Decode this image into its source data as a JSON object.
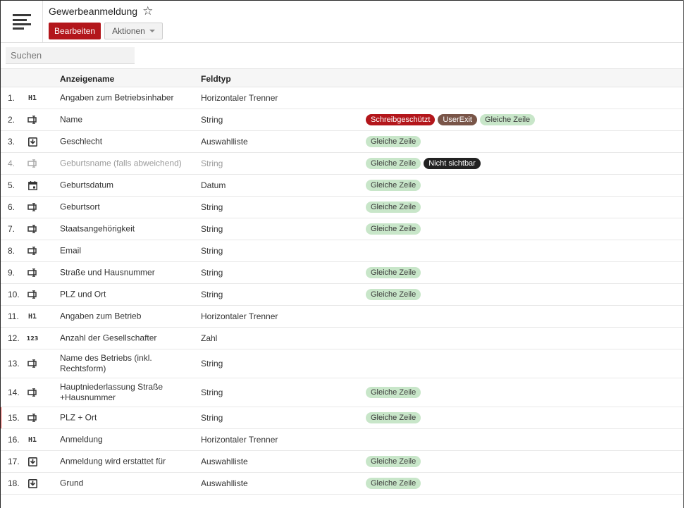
{
  "header": {
    "title": "Gewerbeanmeldung",
    "star_icon": "☆",
    "edit_label": "Bearbeiten",
    "actions_label": "Aktionen"
  },
  "search": {
    "placeholder": "Suchen"
  },
  "table": {
    "columns": {
      "name": "Anzeigename",
      "type": "Feldtyp"
    },
    "rows": [
      {
        "num": "1.",
        "icon": "heading-icon",
        "icon_text": "H1",
        "name": "Angaben zum Betriebsinhaber",
        "type": "Horizontaler Trenner",
        "badges": []
      },
      {
        "num": "2.",
        "icon": "text-field-icon",
        "name": "Name",
        "type": "String",
        "badges": [
          {
            "label": "Schreibgeschützt",
            "style": "red"
          },
          {
            "label": "UserExit",
            "style": "brown"
          },
          {
            "label": "Gleiche Zeile",
            "style": "green"
          }
        ]
      },
      {
        "num": "3.",
        "icon": "dropdown-icon",
        "name": "Geschlecht",
        "type": "Auswahlliste",
        "badges": [
          {
            "label": "Gleiche Zeile",
            "style": "green"
          }
        ]
      },
      {
        "num": "4.",
        "icon": "text-field-icon",
        "name": "Geburtsname (falls abweichend)",
        "type": "String",
        "muted": true,
        "badges": [
          {
            "label": "Gleiche Zeile",
            "style": "green"
          },
          {
            "label": "Nicht sichtbar",
            "style": "black"
          }
        ]
      },
      {
        "num": "5.",
        "icon": "calendar-icon",
        "name": "Geburtsdatum",
        "type": "Datum",
        "badges": [
          {
            "label": "Gleiche Zeile",
            "style": "green"
          }
        ]
      },
      {
        "num": "6.",
        "icon": "text-field-icon",
        "name": "Geburtsort",
        "type": "String",
        "badges": [
          {
            "label": "Gleiche Zeile",
            "style": "green"
          }
        ]
      },
      {
        "num": "7.",
        "icon": "text-field-icon",
        "name": "Staatsangehörigkeit",
        "type": "String",
        "badges": [
          {
            "label": "Gleiche Zeile",
            "style": "green"
          }
        ]
      },
      {
        "num": "8.",
        "icon": "text-field-icon",
        "name": "Email",
        "type": "String",
        "badges": []
      },
      {
        "num": "9.",
        "icon": "text-field-icon",
        "name": "Straße und Hausnummer",
        "type": "String",
        "badges": [
          {
            "label": "Gleiche Zeile",
            "style": "green"
          }
        ]
      },
      {
        "num": "10.",
        "icon": "text-field-icon",
        "name": "PLZ und Ort",
        "type": "String",
        "badges": [
          {
            "label": "Gleiche Zeile",
            "style": "green"
          }
        ]
      },
      {
        "num": "11.",
        "icon": "heading-icon",
        "icon_text": "H1",
        "name": "Angaben zum Betrieb",
        "type": "Horizontaler Trenner",
        "badges": []
      },
      {
        "num": "12.",
        "icon": "number-icon",
        "icon_text": "123",
        "name": "Anzahl der Gesellschafter",
        "type": "Zahl",
        "badges": []
      },
      {
        "num": "13.",
        "icon": "text-field-icon",
        "name": "Name des Betriebs (inkl. Rechtsform)",
        "type": "String",
        "badges": [],
        "tall": true
      },
      {
        "num": "14.",
        "icon": "text-field-icon",
        "name": "Hauptniederlassung Straße +Hausnummer",
        "type": "String",
        "badges": [
          {
            "label": "Gleiche Zeile",
            "style": "green"
          }
        ],
        "tall": true
      },
      {
        "num": "15.",
        "icon": "text-field-icon",
        "name": "PLZ + Ort",
        "type": "String",
        "marked": true,
        "badges": [
          {
            "label": "Gleiche Zeile",
            "style": "green"
          }
        ]
      },
      {
        "num": "16.",
        "icon": "heading-icon",
        "icon_text": "H1",
        "name": "Anmeldung",
        "type": "Horizontaler Trenner",
        "badges": []
      },
      {
        "num": "17.",
        "icon": "dropdown-icon",
        "name": "Anmeldung wird erstattet für",
        "type": "Auswahlliste",
        "badges": [
          {
            "label": "Gleiche Zeile",
            "style": "green"
          }
        ]
      },
      {
        "num": "18.",
        "icon": "dropdown-icon",
        "name": "Grund",
        "type": "Auswahlliste",
        "badges": [
          {
            "label": "Gleiche Zeile",
            "style": "green"
          }
        ]
      }
    ]
  }
}
